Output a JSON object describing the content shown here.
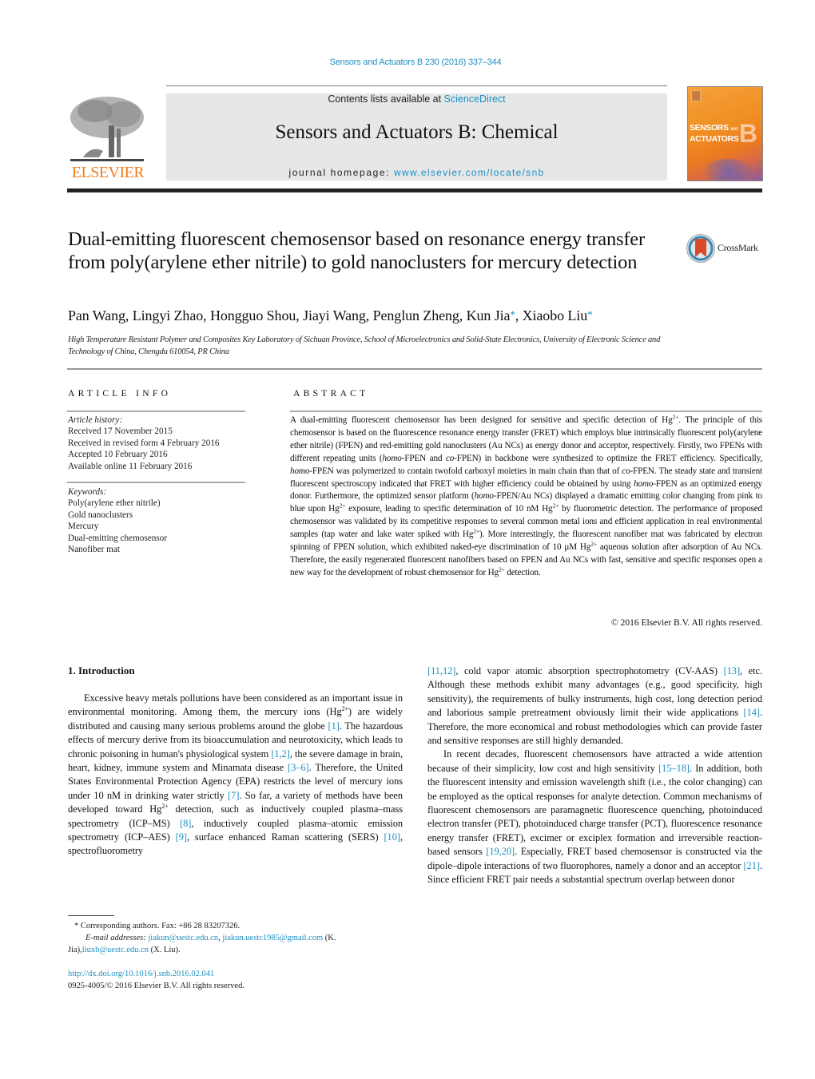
{
  "header": {
    "citation": "Sensors and Actuators B 230 (2016) 337–344",
    "contents_prefix": "Contents lists available at ",
    "contents_link": "ScienceDirect",
    "journal_title": "Sensors and Actuators B: Chemical",
    "homepage_prefix": "journal homepage: ",
    "homepage_link": "www.elsevier.com/locate/snb",
    "publisher_logo_text": "ELSEVIER",
    "cover_line1": "SENSORS",
    "cover_and": "and",
    "cover_line2": "ACTUATORS",
    "cover_letter": "B"
  },
  "article": {
    "title": "Dual-emitting fluorescent chemosensor based on resonance energy transfer from poly(arylene ether nitrile) to gold nanoclusters for mercury detection",
    "crossmark_label": "CrossMark",
    "authors": [
      {
        "name": "Pan Wang",
        "corresponding": false
      },
      {
        "name": "Lingyi Zhao",
        "corresponding": false
      },
      {
        "name": "Hongguo Shou",
        "corresponding": false
      },
      {
        "name": "Jiayi Wang",
        "corresponding": false
      },
      {
        "name": "Penglun Zheng",
        "corresponding": false
      },
      {
        "name": "Kun Jia",
        "corresponding": true
      },
      {
        "name": "Xiaobo Liu",
        "corresponding": true
      }
    ],
    "affiliation": "High Temperature Resistant Polymer and Composites Key Laboratory of Sichuan Province, School of Microelectronics and Solid-State Electronics, University of Electronic Science and Technology of China, Chengdu 610054, PR China"
  },
  "article_info": {
    "heading": "ARTICLE INFO",
    "history_label": "Article history:",
    "history": [
      "Received 17 November 2015",
      "Received in revised form 4 February 2016",
      "Accepted 10 February 2016",
      "Available online 11 February 2016"
    ],
    "keywords_label": "Keywords:",
    "keywords": [
      "Poly(arylene ether nitrile)",
      "Gold nanoclusters",
      "Mercury",
      "Dual-emitting chemosensor",
      "Nanofiber mat"
    ]
  },
  "abstract": {
    "heading": "ABSTRACT",
    "segments": [
      {
        "t": "A dual-emitting fluorescent chemosensor has been designed for sensitive and specific detection of Hg"
      },
      {
        "t": "2+",
        "sup": true
      },
      {
        "t": ". The principle of this chemosensor is based on the fluorescence resonance energy transfer (FRET) which employs blue intrinsically fluorescent poly(arylene ether nitrile) (FPEN) and red-emitting gold nanoclusters (Au NCs) as energy donor and acceptor, respectively. Firstly, two FPENs with different repeating units ("
      },
      {
        "t": "homo",
        "i": true
      },
      {
        "t": "-FPEN and "
      },
      {
        "t": "co",
        "i": true
      },
      {
        "t": "-FPEN) in backbone were synthesized to optimize the FRET efficiency. Specifically, "
      },
      {
        "t": "homo",
        "i": true
      },
      {
        "t": "-FPEN was polymerized to contain twofold carboxyl moieties in main chain than that of "
      },
      {
        "t": "co",
        "i": true
      },
      {
        "t": "-FPEN. The steady state and transient fluorescent spectroscopy indicated that FRET with higher efficiency could be obtained by using "
      },
      {
        "t": "homo",
        "i": true
      },
      {
        "t": "-FPEN as an optimized energy donor. Furthermore, the optimized sensor platform ("
      },
      {
        "t": "homo",
        "i": true
      },
      {
        "t": "-FPEN/Au NCs) displayed a dramatic emitting color changing from pink to blue upon Hg"
      },
      {
        "t": "2+",
        "sup": true
      },
      {
        "t": " exposure, leading to specific determination of 10 nM Hg"
      },
      {
        "t": "2+",
        "sup": true
      },
      {
        "t": " by fluorometric detection. The performance of proposed chemosensor was validated by its competitive responses to several common metal ions and efficient application in real environmental samples (tap water and lake water spiked with Hg"
      },
      {
        "t": "2+",
        "sup": true
      },
      {
        "t": "). More interestingly, the fluorescent nanofiber mat was fabricated by electron spinning of FPEN solution, which exhibited naked-eye discrimination of 10 μM Hg"
      },
      {
        "t": "2+",
        "sup": true
      },
      {
        "t": " aqueous solution after adsorption of Au NCs. Therefore, the easily regenerated fluorescent nanofibers based on FPEN and Au NCs with fast, sensitive and specific responses open a new way for the development of robust chemosensor for Hg"
      },
      {
        "t": "2+",
        "sup": true
      },
      {
        "t": " detection."
      }
    ],
    "copyright": "© 2016 Elsevier B.V. All rights reserved."
  },
  "body": {
    "section_heading": "1.  Introduction",
    "left_paragraphs": [
      [
        {
          "t": "Excessive heavy metals pollutions have been considered as an important issue in environmental monitoring. Among them, the mercury ions (Hg"
        },
        {
          "t": "2+",
          "sup": true
        },
        {
          "t": ") are widely distributed and causing many serious problems around the globe "
        },
        {
          "t": "[1]",
          "cite": true
        },
        {
          "t": ". The hazardous effects of mercury derive from its bioaccumulation and neurotoxicity, which leads to chronic poisoning in human's physiological system "
        },
        {
          "t": "[1,2]",
          "cite": true
        },
        {
          "t": ", the severe damage in brain, heart, kidney, immune system and Minamata disease "
        },
        {
          "t": "[3–6]",
          "cite": true
        },
        {
          "t": ". Therefore, the United States Environmental Protection Agency (EPA) restricts the level of mercury ions under 10 nM in drinking water strictly "
        },
        {
          "t": "[7]",
          "cite": true
        },
        {
          "t": ". So far, a variety of methods have been developed toward Hg"
        },
        {
          "t": "2+",
          "sup": true
        },
        {
          "t": " detection, such as inductively coupled plasma–mass spectrometry (ICP–MS) "
        },
        {
          "t": "[8]",
          "cite": true
        },
        {
          "t": ", inductively coupled plasma–atomic emission spectrometry (ICP–AES) "
        },
        {
          "t": "[9]",
          "cite": true
        },
        {
          "t": ", surface enhanced Raman scattering (SERS) "
        },
        {
          "t": "[10]",
          "cite": true
        },
        {
          "t": ", spectrofluorometry"
        }
      ]
    ],
    "right_paragraphs": [
      [
        {
          "t": "[11,12]",
          "cite": true
        },
        {
          "t": ", cold vapor atomic absorption spectrophotometry (CV-AAS) "
        },
        {
          "t": "[13]",
          "cite": true
        },
        {
          "t": ", etc. Although these methods exhibit many advantages (e.g., good specificity, high sensitivity), the requirements of bulky instruments, high cost, long detection period and laborious sample pretreatment obviously limit their wide applications "
        },
        {
          "t": "[14]",
          "cite": true
        },
        {
          "t": ". Therefore, the more economical and robust methodologies which can provide faster and sensitive responses are still highly demanded."
        }
      ],
      [
        {
          "t": "In recent decades, fluorescent chemosensors have attracted a wide attention because of their simplicity, low cost and high sensitivity "
        },
        {
          "t": "[15–18]",
          "cite": true
        },
        {
          "t": ". In addition, both the fluorescent intensity and emission wavelength shift (i.e., the color changing) can be employed as the optical responses for analyte detection. Common mechanisms of fluorescent chemosensors are paramagnetic fluorescence quenching, photoinduced electron transfer (PET), photoinduced charge transfer (PCT), fluorescence resonance energy transfer (FRET), excimer or exciplex formation and irreversible reaction-based sensors "
        },
        {
          "t": "[19,20]",
          "cite": true
        },
        {
          "t": ". Especially, FRET based chemosensor is constructed via the dipole–dipole interactions of two fluorophores, namely a donor and an acceptor "
        },
        {
          "t": "[21]",
          "cite": true
        },
        {
          "t": ". Since efficient FRET pair needs a substantial spectrum overlap between donor"
        }
      ]
    ]
  },
  "footnotes": {
    "corresponding": "*  Corresponding authors. Fax: +86 28 83207326.",
    "email_label": "E-mail addresses: ",
    "emails": [
      {
        "address": "jiakun@uestc.edu.cn",
        "after": ", "
      },
      {
        "address": "jiakun.uestc1985@gmail.com",
        "after": " (K. Jia),"
      },
      {
        "address": "liuxb@uestc.edu.cn",
        "after": " (X. Liu)."
      }
    ],
    "doi": "http://dx.doi.org/10.1016/j.snb.2016.02.041",
    "issn_line": "0925-4005/© 2016 Elsevier B.V. All rights reserved."
  },
  "colors": {
    "link": "#1d8fc1",
    "elsevier_orange": "#f07f1e",
    "banner_bg": "#e6e7e8"
  }
}
